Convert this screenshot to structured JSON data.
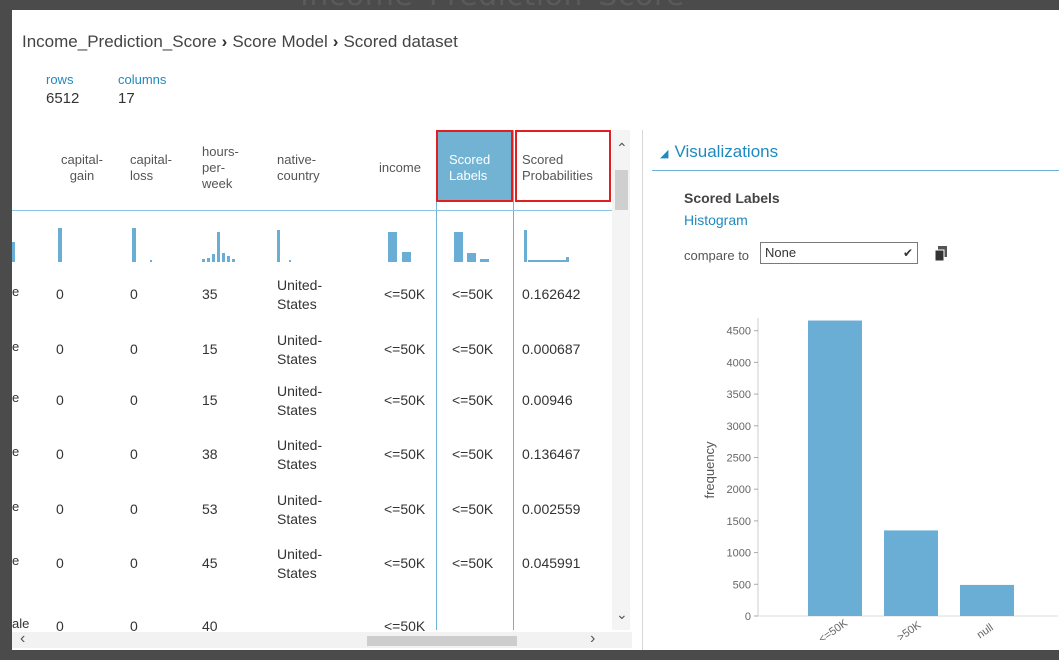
{
  "background_title": "Income_Prediction_Score",
  "breadcrumb": [
    "Income_Prediction_Score",
    "Score Model",
    "Scored dataset"
  ],
  "breadcrumb_separator": "›",
  "stats": {
    "rows_label": "rows",
    "rows_value": "6512",
    "columns_label": "columns",
    "columns_value": "17"
  },
  "table": {
    "columns": [
      {
        "label": "capital-\ngain"
      },
      {
        "label": "capital-\nloss"
      },
      {
        "label": "hours-\nper-\nweek"
      },
      {
        "label": "native-\ncountry"
      },
      {
        "label": "income"
      },
      {
        "label": "Scored\nLabels"
      },
      {
        "label": "Scored\nProbabilities"
      }
    ],
    "rows": [
      {
        "left": "e",
        "cells": [
          "0",
          "0",
          "35",
          "United-\nStates",
          "<=50K",
          "<=50K",
          "0.162642"
        ]
      },
      {
        "left": "e",
        "cells": [
          "0",
          "0",
          "15",
          "United-\nStates",
          "<=50K",
          "<=50K",
          "0.000687"
        ]
      },
      {
        "left": "e",
        "cells": [
          "0",
          "0",
          "15",
          "United-\nStates",
          "<=50K",
          "<=50K",
          "0.00946"
        ]
      },
      {
        "left": "e",
        "cells": [
          "0",
          "0",
          "38",
          "United-\nStates",
          "<=50K",
          "<=50K",
          "0.136467"
        ]
      },
      {
        "left": "e",
        "cells": [
          "0",
          "0",
          "53",
          "United-\nStates",
          "<=50K",
          "<=50K",
          "0.002559"
        ]
      },
      {
        "left": "e",
        "cells": [
          "0",
          "0",
          "45",
          "United-\nStates",
          "<=50K",
          "<=50K",
          "0.045991"
        ]
      },
      {
        "left": "ale",
        "cells": [
          "0",
          "0",
          "40",
          "",
          "<=50K",
          "",
          ""
        ]
      }
    ]
  },
  "visualizations": {
    "section_title": "Visualizations",
    "column_name": "Scored Labels",
    "chart_kind": "Histogram",
    "compare_label": "compare to",
    "compare_value": "None"
  },
  "colors": {
    "accent": "#1f8ac0",
    "bar": "#6aaed6",
    "selected_header": "#72b3d3",
    "highlight_box": "#e02020"
  },
  "chart_data": {
    "type": "bar",
    "categories": [
      "<=50K",
      ">50K",
      "null"
    ],
    "values": [
      4660,
      1350,
      490
    ],
    "title": "",
    "xlabel": "",
    "ylabel": "frequency",
    "ylim": [
      0,
      4700
    ],
    "yticks": [
      0,
      500,
      1000,
      1500,
      2000,
      2500,
      3000,
      3500,
      4000,
      4500
    ]
  }
}
